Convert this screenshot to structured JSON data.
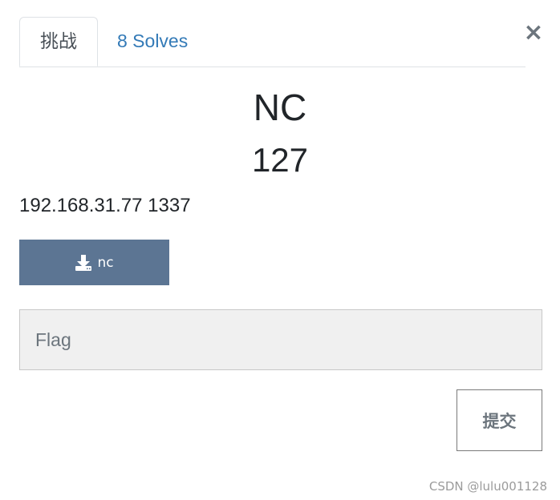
{
  "tabs": [
    {
      "label": "挑战",
      "active": true
    },
    {
      "label": "8 Solves",
      "active": false
    }
  ],
  "close": {
    "icon": "close-icon",
    "glyph": "×"
  },
  "challenge": {
    "name": "NC",
    "value": "127",
    "description": "192.168.31.77 1337"
  },
  "download": {
    "icon": "download-icon",
    "label": "nc"
  },
  "flag_input": {
    "value": "",
    "placeholder": "Flag"
  },
  "submit": {
    "label": "提交"
  },
  "watermark": "CSDN @lulu001128",
  "colors": {
    "tab_link": "#337ab7",
    "download_button": "#5c7593",
    "input_background": "#f0f0f0"
  }
}
